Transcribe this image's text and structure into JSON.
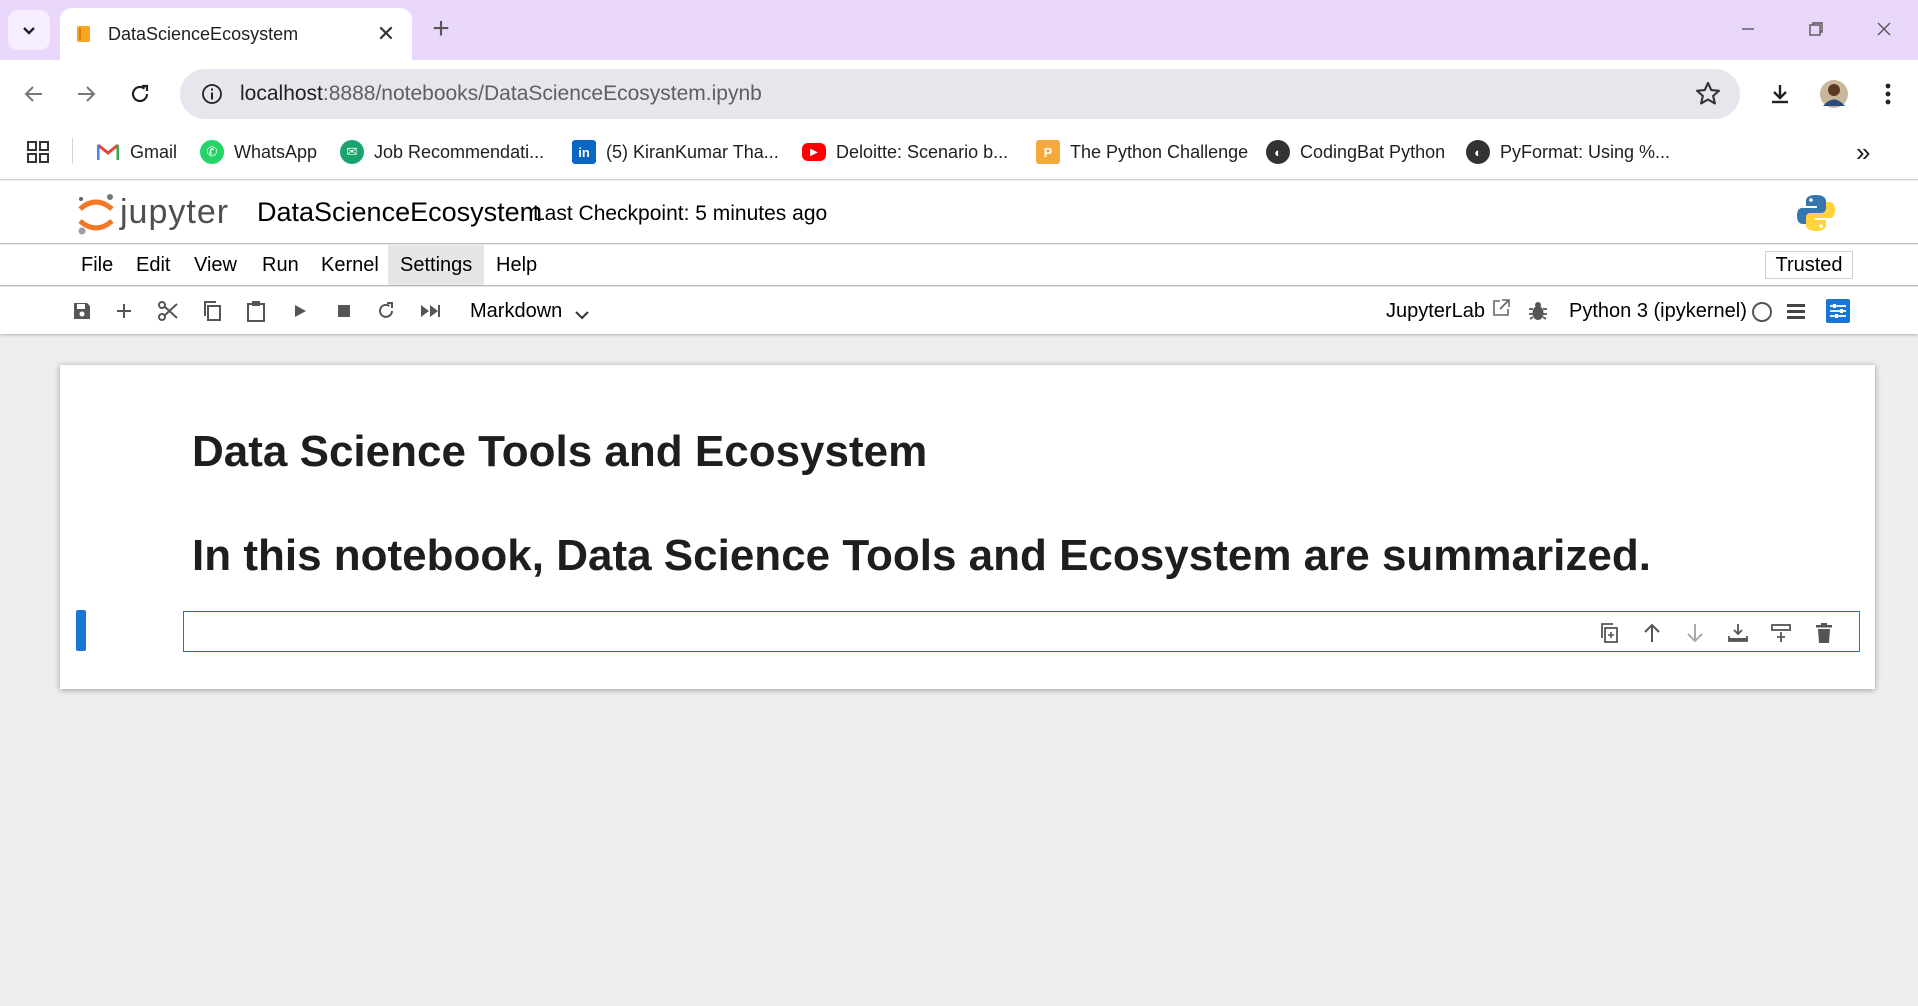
{
  "browser": {
    "tab": {
      "title": "DataScienceEcosystem",
      "close": "✕"
    },
    "new_tab": "+",
    "address": {
      "host": "localhost",
      "rest": ":8888/notebooks/DataScienceEcosystem.ipynb"
    },
    "bookmarks": [
      {
        "label": "Gmail",
        "icon": "gmail-icon"
      },
      {
        "label": "WhatsApp",
        "icon": "whatsapp-icon"
      },
      {
        "label": "Job Recommendati...",
        "icon": "job-icon"
      },
      {
        "label": "(5) KiranKumar Tha...",
        "icon": "linkedin-icon"
      },
      {
        "label": "Deloitte: Scenario b...",
        "icon": "youtube-icon"
      },
      {
        "label": "The Python Challenge",
        "icon": "python-challenge-icon"
      },
      {
        "label": "CodingBat Python",
        "icon": "globe-icon"
      },
      {
        "label": "PyFormat: Using %...",
        "icon": "globe-icon"
      }
    ],
    "more_bookmarks": "»"
  },
  "jupyter": {
    "wordmark": "jupyter",
    "notebook_title": "DataScienceEcosystem",
    "checkpoint": "Last Checkpoint: 5 minutes ago",
    "menu": [
      "File",
      "Edit",
      "View",
      "Run",
      "Kernel",
      "Settings",
      "Help"
    ],
    "trusted": "Trusted",
    "toolbar": {
      "cell_type": "Markdown",
      "jupyterlab": "JupyterLab",
      "kernel": "Python 3 (ipykernel)"
    }
  },
  "notebook": {
    "heading1": "Data Science Tools and Ecosystem",
    "heading2": "In this notebook, Data Science Tools and Ecosystem are summarized."
  },
  "colors": {
    "tabbar": "#e9d8fb",
    "cell_accent": "#1976d2",
    "jupyter_orange": "#f37726"
  }
}
